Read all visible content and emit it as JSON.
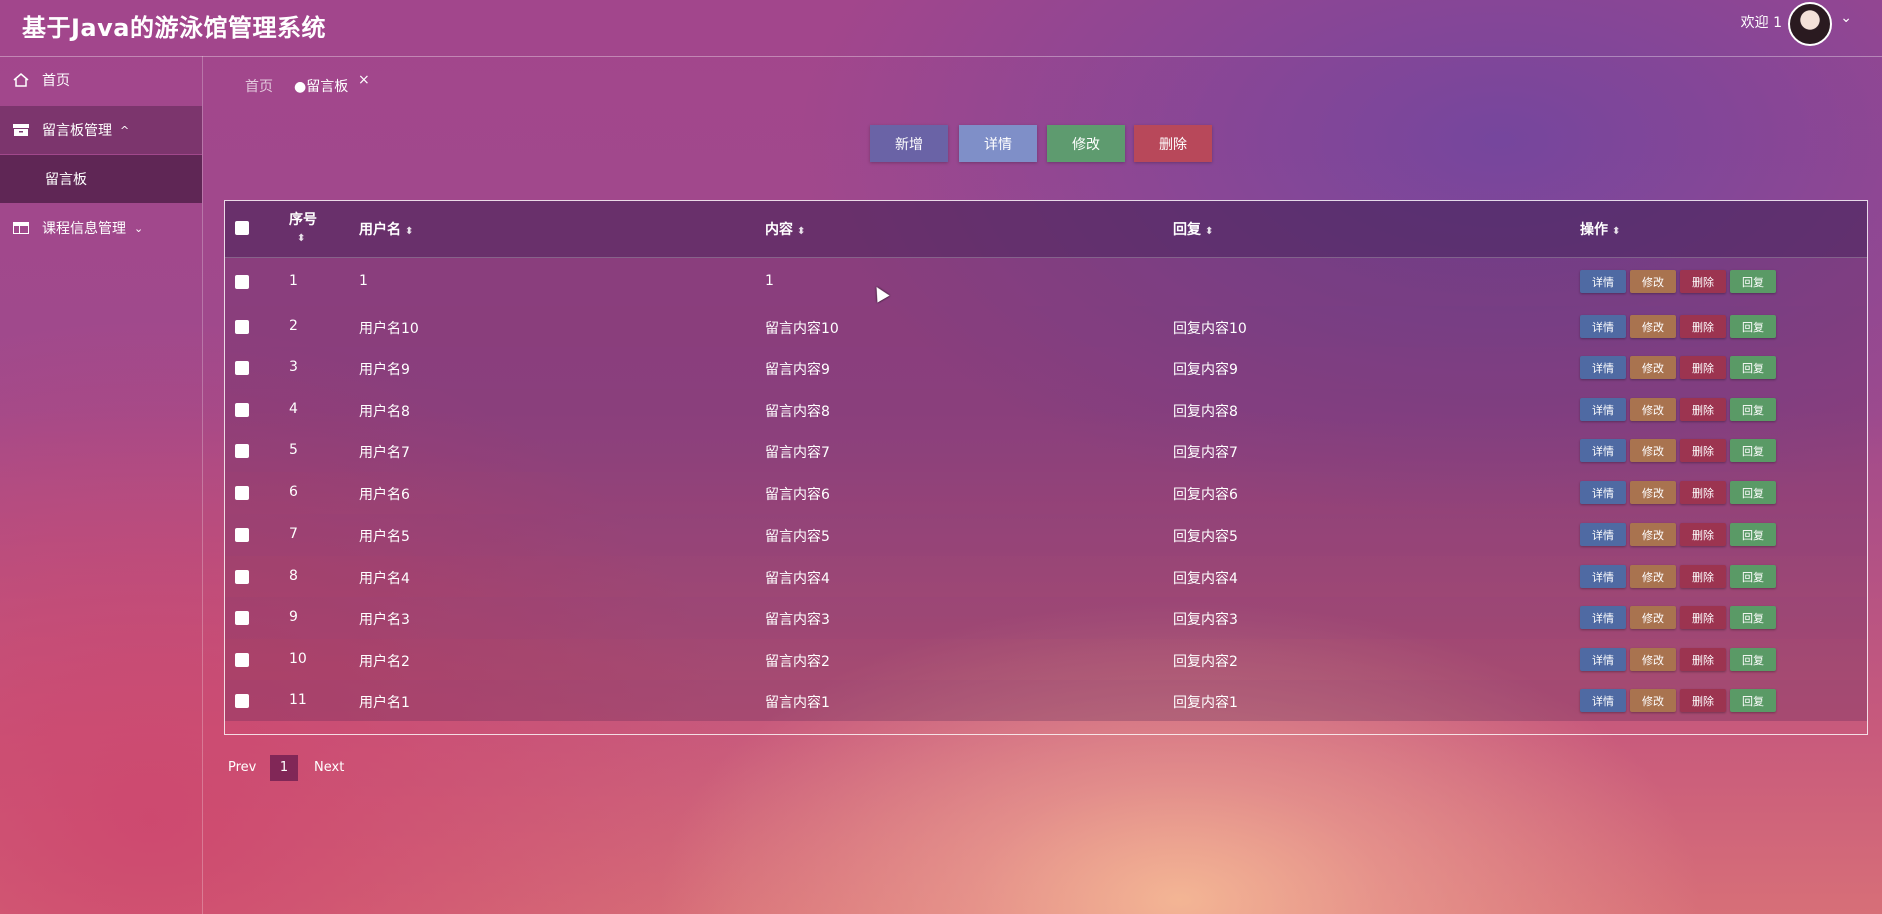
{
  "header": {
    "title": "基于Java的游泳馆管理系统",
    "welcome": "欢迎 1"
  },
  "sidebar": {
    "items": [
      {
        "label": "首页",
        "icon": "home-icon"
      },
      {
        "label": "留言板管理",
        "icon": "archive-icon",
        "expanded": true
      },
      {
        "label": "留言板",
        "sub": true
      },
      {
        "label": "课程信息管理",
        "icon": "table-icon",
        "expanded": false
      }
    ]
  },
  "tabs": {
    "home": "首页",
    "active": "●留言板",
    "close": "×"
  },
  "toolbar": {
    "new": "新增",
    "detail": "详情",
    "edit": "修改",
    "delete": "删除"
  },
  "table": {
    "headers": {
      "index": "序号",
      "username": "用户名",
      "content": "内容",
      "reply": "回复",
      "actions": "操作"
    },
    "action_labels": {
      "detail": "详情",
      "edit": "修改",
      "delete": "删除",
      "reply": "回复"
    },
    "rows": [
      {
        "index": "1",
        "username": "1",
        "content": "1",
        "reply": ""
      },
      {
        "index": "2",
        "username": "用户名10",
        "content": "留言内容10",
        "reply": "回复内容10"
      },
      {
        "index": "3",
        "username": "用户名9",
        "content": "留言内容9",
        "reply": "回复内容9"
      },
      {
        "index": "4",
        "username": "用户名8",
        "content": "留言内容8",
        "reply": "回复内容8"
      },
      {
        "index": "5",
        "username": "用户名7",
        "content": "留言内容7",
        "reply": "回复内容7"
      },
      {
        "index": "6",
        "username": "用户名6",
        "content": "留言内容6",
        "reply": "回复内容6"
      },
      {
        "index": "7",
        "username": "用户名5",
        "content": "留言内容5",
        "reply": "回复内容5"
      },
      {
        "index": "8",
        "username": "用户名4",
        "content": "留言内容4",
        "reply": "回复内容4"
      },
      {
        "index": "9",
        "username": "用户名3",
        "content": "留言内容3",
        "reply": "回复内容3"
      },
      {
        "index": "10",
        "username": "用户名2",
        "content": "留言内容2",
        "reply": "回复内容2"
      },
      {
        "index": "11",
        "username": "用户名1",
        "content": "留言内容1",
        "reply": "回复内容1"
      }
    ]
  },
  "pagination": {
    "prev": "Prev",
    "current": "1",
    "next": "Next"
  },
  "colors": {
    "btn_detail": "#4f6aa3",
    "btn_edit": "#a9734f",
    "btn_delete": "#9c3450",
    "btn_reply": "#5a9a66"
  }
}
